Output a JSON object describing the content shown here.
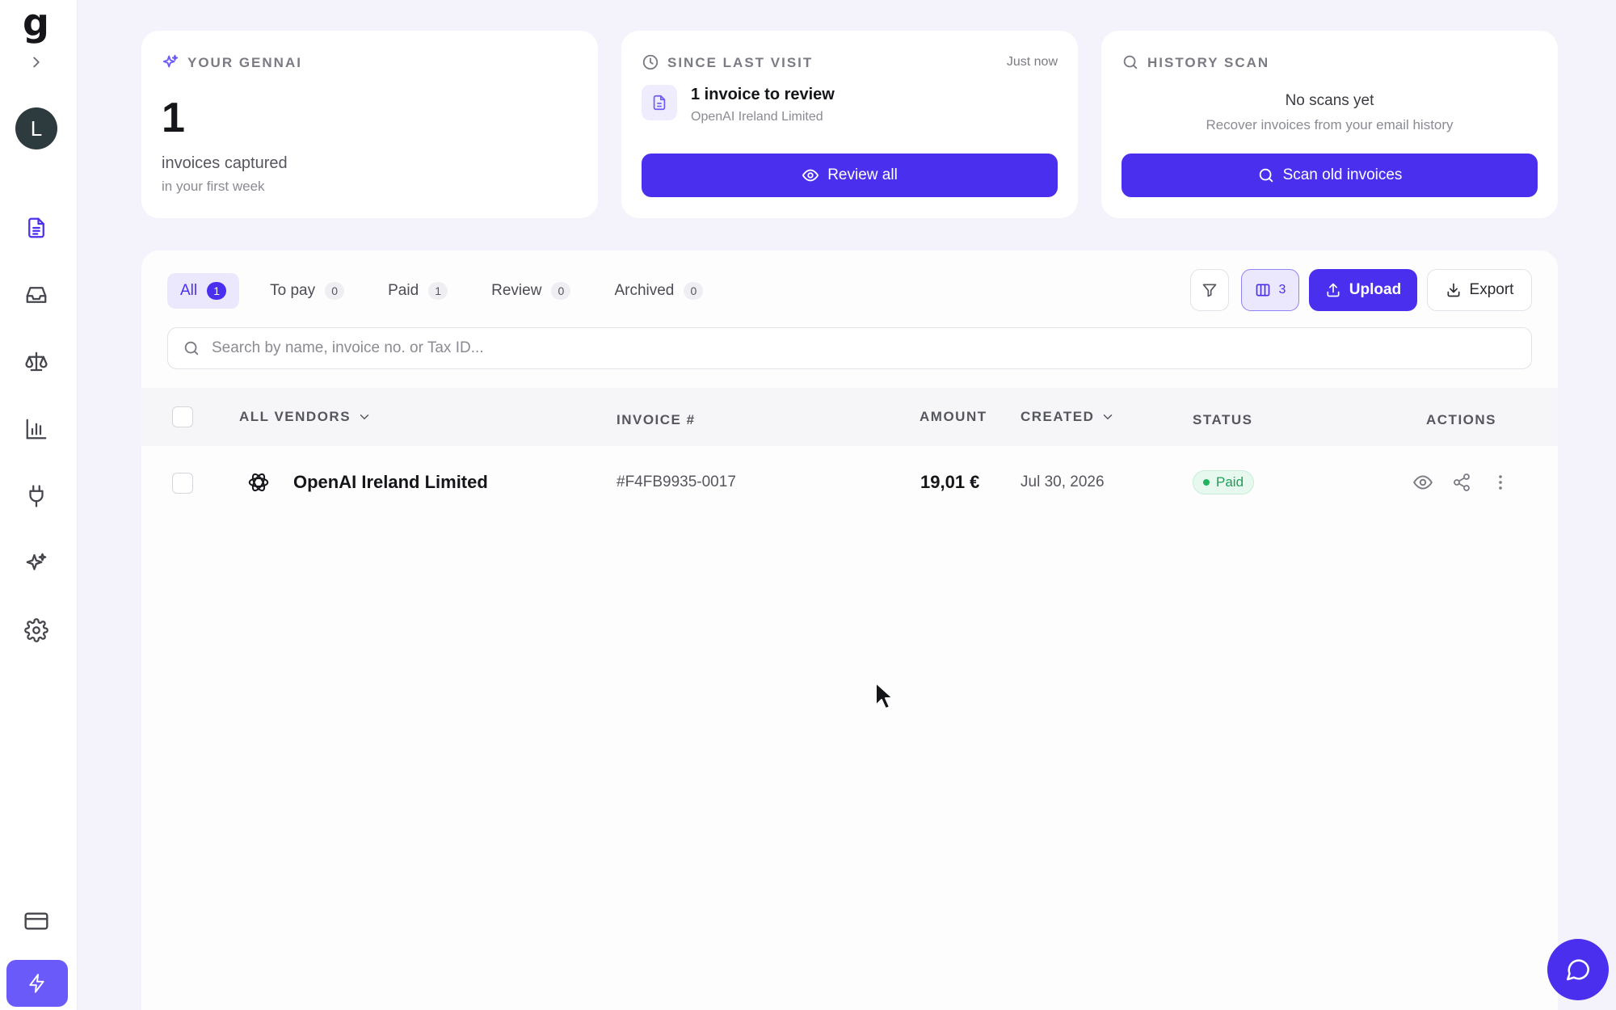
{
  "sidebar": {
    "logo": "g",
    "avatar_initial": "L",
    "nav_icons": [
      "invoices-icon",
      "inbox-icon",
      "balance-icon",
      "chart-icon",
      "plug-icon",
      "sparkles-icon",
      "gear-icon"
    ],
    "bottom_icons": [
      "credit-card-icon",
      "bolt-icon"
    ]
  },
  "cards": {
    "gennai": {
      "title": "YOUR GENNAI",
      "count": "1",
      "label": "invoices captured",
      "sub": "in your first week"
    },
    "since_last_visit": {
      "title": "SINCE LAST VISIT",
      "time": "Just now",
      "headline": "1 invoice to review",
      "vendor": "OpenAI Ireland Limited",
      "button": "Review all"
    },
    "history_scan": {
      "title": "HISTORY SCAN",
      "headline": "No scans yet",
      "sub": "Recover invoices from your email history",
      "button": "Scan old invoices"
    }
  },
  "tabs": [
    {
      "label": "All",
      "count": "1"
    },
    {
      "label": "To pay",
      "count": "0"
    },
    {
      "label": "Paid",
      "count": "1"
    },
    {
      "label": "Review",
      "count": "0"
    },
    {
      "label": "Archived",
      "count": "0"
    }
  ],
  "toolbar": {
    "columns_count": "3",
    "upload": "Upload",
    "export": "Export"
  },
  "search": {
    "placeholder": "Search by name, invoice no. or Tax ID..."
  },
  "table": {
    "headers": {
      "vendor": "ALL VENDORS",
      "invoice": "INVOICE #",
      "amount": "AMOUNT",
      "created": "CREATED",
      "status": "STATUS",
      "actions": "ACTIONS"
    },
    "rows": [
      {
        "vendor": "OpenAI Ireland Limited",
        "invoice": "#F4FB9935-0017",
        "amount": "19,01 €",
        "created": "Jul 30, 2026",
        "status": "Paid"
      }
    ]
  },
  "colors": {
    "accent": "#4a2fef",
    "accent_light": "#ebe8fd",
    "paid_green": "#1f9d57",
    "background": "#f4f3fc"
  }
}
